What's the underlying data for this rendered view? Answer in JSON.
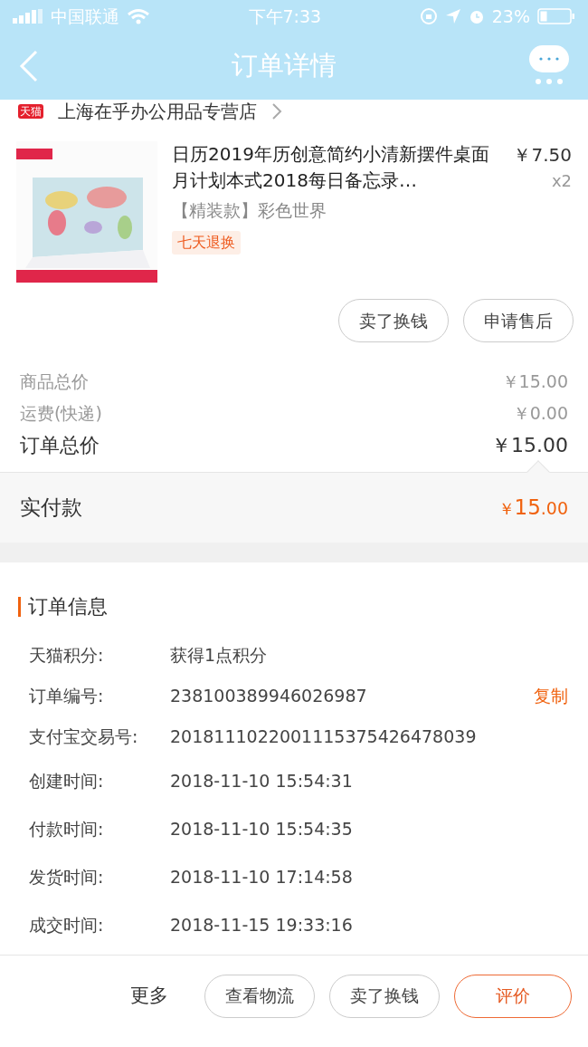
{
  "status_bar": {
    "carrier": "中国联通",
    "time": "下午7:33",
    "battery": "23%"
  },
  "nav": {
    "title": "订单详情"
  },
  "store": {
    "badge": "天猫",
    "name": "上海在乎办公用品专营店"
  },
  "product": {
    "kind": "picture",
    "title": "日历2019年历创意简约小清新摆件桌面月计划本式2018每日备忘录…",
    "variant": "【精装款】彩色世界",
    "tag": "七天退换",
    "price": "￥7.50",
    "quantity": "x2"
  },
  "product_actions": [
    "卖了换钱",
    "申请售后"
  ],
  "price_rows": [
    {
      "label": "商品总价",
      "value": "￥15.00",
      "kind": "sub"
    },
    {
      "label": "运费(快递)",
      "value": "￥0.00",
      "kind": "sub"
    },
    {
      "label": "订单总价",
      "value": "￥15.00",
      "kind": "total"
    }
  ],
  "paid": {
    "label": "实付款",
    "currency": "￥",
    "amount": "15",
    "decimals": ".00"
  },
  "order_info": {
    "title": "订单信息",
    "rows": [
      {
        "label": "天猫积分:",
        "value": "获得1点积分"
      },
      {
        "label": "订单编号:",
        "value": "238100389946026987",
        "action": "复制"
      },
      {
        "label": "支付宝交易号:",
        "value": "2018111022001115375426478039"
      },
      {
        "label": "创建时间:",
        "value": "2018-11-10 15:54:31"
      },
      {
        "label": "付款时间:",
        "value": "2018-11-10 15:54:35"
      },
      {
        "label": "发货时间:",
        "value": "2018-11-10 17:14:58"
      },
      {
        "label": "成交时间:",
        "value": "2018-11-15 19:33:16"
      }
    ]
  },
  "bottom_bar": {
    "more": "更多",
    "buttons": [
      {
        "label": "查看物流",
        "kind": "default"
      },
      {
        "label": "卖了换钱",
        "kind": "default"
      },
      {
        "label": "评价",
        "kind": "primary"
      }
    ]
  }
}
